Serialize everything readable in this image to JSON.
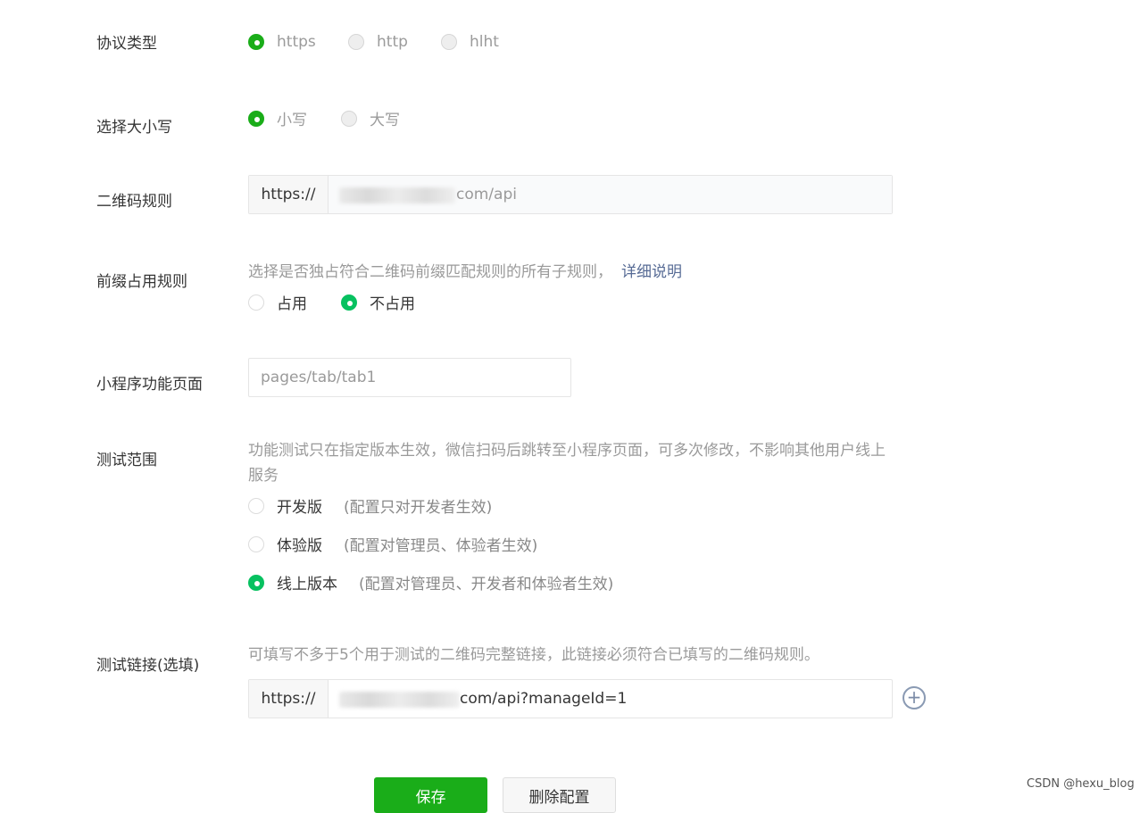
{
  "protocol": {
    "label": "协议类型",
    "options": [
      "https",
      "http",
      "hlht"
    ],
    "selected": "https"
  },
  "case": {
    "label": "选择大小写",
    "options": [
      "小写",
      "大写"
    ],
    "selected": "小写"
  },
  "qr_rule": {
    "label": "二维码规则",
    "prefix": "https://",
    "value_visible": "com/api"
  },
  "prefix_rule": {
    "label": "前缀占用规则",
    "hint": "选择是否独占符合二维码前缀匹配规则的所有子规则，",
    "link": "详细说明",
    "options": [
      "占用",
      "不占用"
    ],
    "selected": "不占用"
  },
  "page": {
    "label": "小程序功能页面",
    "placeholder": "pages/tab/tab1"
  },
  "test_scope": {
    "label": "测试范围",
    "hint": "功能测试只在指定版本生效，微信扫码后跳转至小程序页面，可多次修改，不影响其他用户线上服务",
    "options": [
      {
        "label": "开发版",
        "note": "(配置只对开发者生效)"
      },
      {
        "label": "体验版",
        "note": "(配置对管理员、体验者生效)"
      },
      {
        "label": "线上版本",
        "note": "(配置对管理员、开发者和体验者生效)"
      }
    ],
    "selected": "线上版本"
  },
  "test_link": {
    "label": "测试链接(选填)",
    "hint": "可填写不多于5个用于测试的二维码完整链接，此链接必须符合已填写的二维码规则。",
    "prefix": "https://",
    "value_visible": "com/api?manageId=1",
    "add_icon": "plus-circle-icon"
  },
  "actions": {
    "save": "保存",
    "delete": "删除配置"
  },
  "watermark": "CSDN @hexu_blog",
  "colors": {
    "primary_green": "#1aad19",
    "radio_green": "#07c160",
    "link": "#576b95"
  }
}
